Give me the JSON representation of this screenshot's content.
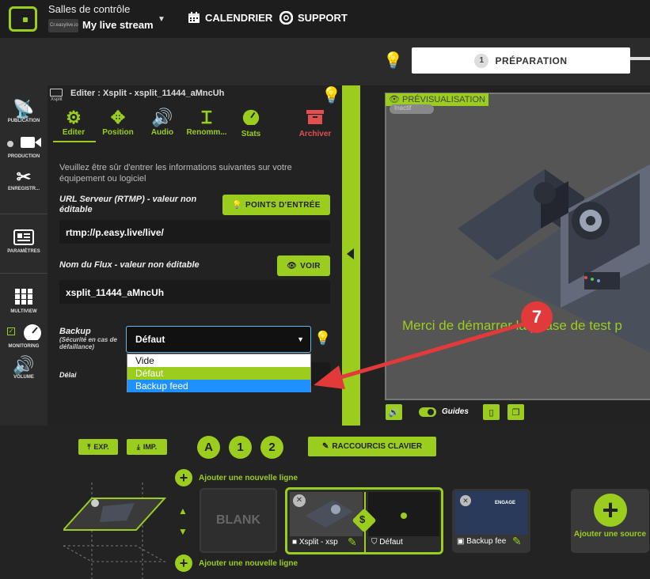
{
  "header": {
    "control_rooms_label": "Salles de contrôle",
    "stream_thumb_text": "Cr.easylive.io",
    "stream_name": "My live stream",
    "calendar_label": "CALENDRIER",
    "support_label": "SUPPORT"
  },
  "steps": {
    "current_number": "1",
    "current_label": "PRÉPARATION"
  },
  "left_nav": [
    {
      "label": "PUBLICATION",
      "icon": "broadcast-icon"
    },
    {
      "label": "PRODUCTION",
      "icon": "camera-icon"
    },
    {
      "label": "ENREGISTR...",
      "icon": "scissors-icon"
    },
    {
      "label": "PARAMÈTRES",
      "icon": "settings-panel-icon"
    },
    {
      "label": "MULTIVIEW",
      "icon": "grid-icon"
    },
    {
      "label": "MONITORING",
      "icon": "gauge-icon"
    },
    {
      "label": "VOLUME",
      "icon": "speaker-icon"
    }
  ],
  "editor": {
    "source_type": "Xsplit",
    "title": "Editer : Xsplit - xsplit_11444_aMncUh",
    "tabs": [
      {
        "label": "Editer",
        "icon": "gear-icon"
      },
      {
        "label": "Position",
        "icon": "move-icon"
      },
      {
        "label": "Audio",
        "icon": "speaker-icon"
      },
      {
        "label": "Renomm...",
        "icon": "text-cursor-icon"
      },
      {
        "label": "Stats",
        "icon": "gauge-icon"
      },
      {
        "label": "Archiver",
        "icon": "archive-icon"
      }
    ],
    "info_text": "Veuillez être sûr d'entrer les informations suivantes sur votre équipement ou logiciel",
    "rtmp_label": "URL Serveur (RTMP) - valeur non éditable",
    "entry_points_button": "POINTS D'ENTRÉE",
    "rtmp_value": "rtmp://p.easy.live/live/",
    "stream_key_label": "Nom du Flux - valeur non éditable",
    "view_button": "VOIR",
    "stream_key_value": "xsplit_11444_aMncUh",
    "backup_label": "Backup",
    "backup_sublabel": "(Sécurité en cas de défaillance)",
    "backup_selected": "Défaut",
    "delay_label": "Délai",
    "dropdown_options": [
      "Vide",
      "Défaut",
      "Backup feed"
    ]
  },
  "preview": {
    "label": "PRÉVISUALISATION",
    "badge_text": "Inactif",
    "message": "Merci de démarrer la phase de test p",
    "guides_label": "Guides"
  },
  "annotation": {
    "step_number": "7",
    "color": "#e23a3a"
  },
  "bottom": {
    "export_label": "EXP.",
    "import_label": "IMP.",
    "scene_buttons": [
      "A",
      "1",
      "2"
    ],
    "shortcuts_label": "RACCOURCIS CLAVIER",
    "add_line_top": "Ajouter une nouvelle ligne",
    "add_line_bottom": "Ajouter une nouvelle ligne",
    "blank_label": "BLANK",
    "card1_source": "Xsplit - xsp",
    "card1_backup": "Défaut",
    "card2_source": "Backup fee",
    "card2_badge": "ENGAGE",
    "add_source_label": "Ajouter une source"
  },
  "colors": {
    "accent": "#9acd1e",
    "select_border": "#66b8e8",
    "hover_option": "#1e90ff",
    "archive": "#e05050"
  }
}
